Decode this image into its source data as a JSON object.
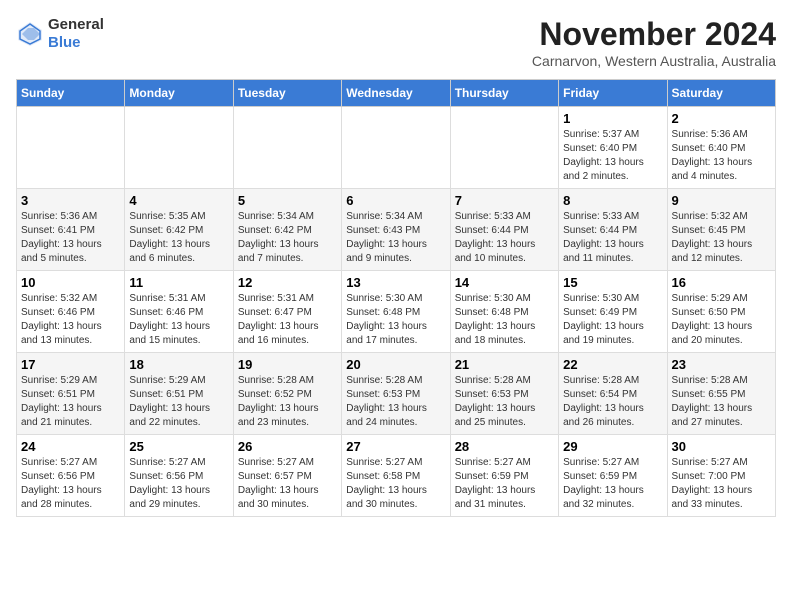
{
  "logo": {
    "general": "General",
    "blue": "Blue"
  },
  "title": "November 2024",
  "subtitle": "Carnarvon, Western Australia, Australia",
  "headers": [
    "Sunday",
    "Monday",
    "Tuesday",
    "Wednesday",
    "Thursday",
    "Friday",
    "Saturday"
  ],
  "weeks": [
    [
      {
        "day": "",
        "info": ""
      },
      {
        "day": "",
        "info": ""
      },
      {
        "day": "",
        "info": ""
      },
      {
        "day": "",
        "info": ""
      },
      {
        "day": "",
        "info": ""
      },
      {
        "day": "1",
        "info": "Sunrise: 5:37 AM\nSunset: 6:40 PM\nDaylight: 13 hours\nand 2 minutes."
      },
      {
        "day": "2",
        "info": "Sunrise: 5:36 AM\nSunset: 6:40 PM\nDaylight: 13 hours\nand 4 minutes."
      }
    ],
    [
      {
        "day": "3",
        "info": "Sunrise: 5:36 AM\nSunset: 6:41 PM\nDaylight: 13 hours\nand 5 minutes."
      },
      {
        "day": "4",
        "info": "Sunrise: 5:35 AM\nSunset: 6:42 PM\nDaylight: 13 hours\nand 6 minutes."
      },
      {
        "day": "5",
        "info": "Sunrise: 5:34 AM\nSunset: 6:42 PM\nDaylight: 13 hours\nand 7 minutes."
      },
      {
        "day": "6",
        "info": "Sunrise: 5:34 AM\nSunset: 6:43 PM\nDaylight: 13 hours\nand 9 minutes."
      },
      {
        "day": "7",
        "info": "Sunrise: 5:33 AM\nSunset: 6:44 PM\nDaylight: 13 hours\nand 10 minutes."
      },
      {
        "day": "8",
        "info": "Sunrise: 5:33 AM\nSunset: 6:44 PM\nDaylight: 13 hours\nand 11 minutes."
      },
      {
        "day": "9",
        "info": "Sunrise: 5:32 AM\nSunset: 6:45 PM\nDaylight: 13 hours\nand 12 minutes."
      }
    ],
    [
      {
        "day": "10",
        "info": "Sunrise: 5:32 AM\nSunset: 6:46 PM\nDaylight: 13 hours\nand 13 minutes."
      },
      {
        "day": "11",
        "info": "Sunrise: 5:31 AM\nSunset: 6:46 PM\nDaylight: 13 hours\nand 15 minutes."
      },
      {
        "day": "12",
        "info": "Sunrise: 5:31 AM\nSunset: 6:47 PM\nDaylight: 13 hours\nand 16 minutes."
      },
      {
        "day": "13",
        "info": "Sunrise: 5:30 AM\nSunset: 6:48 PM\nDaylight: 13 hours\nand 17 minutes."
      },
      {
        "day": "14",
        "info": "Sunrise: 5:30 AM\nSunset: 6:48 PM\nDaylight: 13 hours\nand 18 minutes."
      },
      {
        "day": "15",
        "info": "Sunrise: 5:30 AM\nSunset: 6:49 PM\nDaylight: 13 hours\nand 19 minutes."
      },
      {
        "day": "16",
        "info": "Sunrise: 5:29 AM\nSunset: 6:50 PM\nDaylight: 13 hours\nand 20 minutes."
      }
    ],
    [
      {
        "day": "17",
        "info": "Sunrise: 5:29 AM\nSunset: 6:51 PM\nDaylight: 13 hours\nand 21 minutes."
      },
      {
        "day": "18",
        "info": "Sunrise: 5:29 AM\nSunset: 6:51 PM\nDaylight: 13 hours\nand 22 minutes."
      },
      {
        "day": "19",
        "info": "Sunrise: 5:28 AM\nSunset: 6:52 PM\nDaylight: 13 hours\nand 23 minutes."
      },
      {
        "day": "20",
        "info": "Sunrise: 5:28 AM\nSunset: 6:53 PM\nDaylight: 13 hours\nand 24 minutes."
      },
      {
        "day": "21",
        "info": "Sunrise: 5:28 AM\nSunset: 6:53 PM\nDaylight: 13 hours\nand 25 minutes."
      },
      {
        "day": "22",
        "info": "Sunrise: 5:28 AM\nSunset: 6:54 PM\nDaylight: 13 hours\nand 26 minutes."
      },
      {
        "day": "23",
        "info": "Sunrise: 5:28 AM\nSunset: 6:55 PM\nDaylight: 13 hours\nand 27 minutes."
      }
    ],
    [
      {
        "day": "24",
        "info": "Sunrise: 5:27 AM\nSunset: 6:56 PM\nDaylight: 13 hours\nand 28 minutes."
      },
      {
        "day": "25",
        "info": "Sunrise: 5:27 AM\nSunset: 6:56 PM\nDaylight: 13 hours\nand 29 minutes."
      },
      {
        "day": "26",
        "info": "Sunrise: 5:27 AM\nSunset: 6:57 PM\nDaylight: 13 hours\nand 30 minutes."
      },
      {
        "day": "27",
        "info": "Sunrise: 5:27 AM\nSunset: 6:58 PM\nDaylight: 13 hours\nand 30 minutes."
      },
      {
        "day": "28",
        "info": "Sunrise: 5:27 AM\nSunset: 6:59 PM\nDaylight: 13 hours\nand 31 minutes."
      },
      {
        "day": "29",
        "info": "Sunrise: 5:27 AM\nSunset: 6:59 PM\nDaylight: 13 hours\nand 32 minutes."
      },
      {
        "day": "30",
        "info": "Sunrise: 5:27 AM\nSunset: 7:00 PM\nDaylight: 13 hours\nand 33 minutes."
      }
    ]
  ]
}
